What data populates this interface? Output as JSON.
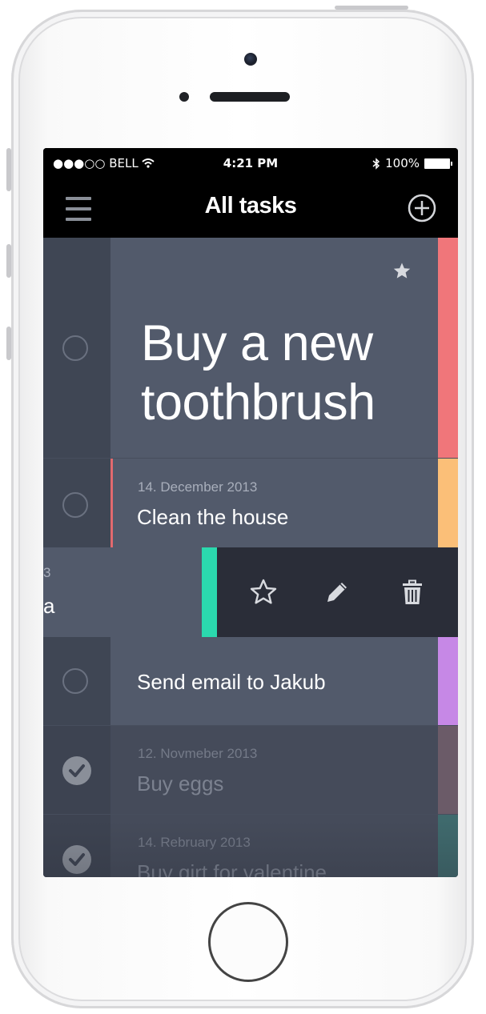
{
  "status_bar": {
    "carrier": "●●●○○ BELL",
    "time": "4:21 PM",
    "battery": "100%"
  },
  "nav": {
    "title": "All tasks"
  },
  "tasks": [
    {
      "title_line1": "Buy a new",
      "title_line2": "toothbrush",
      "starred": true,
      "accent": "#f0767a"
    },
    {
      "date": "14. December 2013",
      "title": "Clean the house",
      "accent": "#fbbf78",
      "marker": "#e26a6e"
    },
    {
      "date": "3",
      "title": "a",
      "accent": "#2bd9ae"
    },
    {
      "title": "Send email to Jakub",
      "accent": "#c688e6"
    },
    {
      "date": "12. Novmeber 2013",
      "title": "Buy eggs",
      "done": true,
      "accent": "#6b5b68"
    },
    {
      "date": "14. Rebruary 2013",
      "title": "Buy girt for valentine",
      "done": true,
      "accent": "#3f6a6d"
    }
  ],
  "swipe_actions": [
    "star-icon",
    "edit-icon",
    "trash-icon"
  ]
}
